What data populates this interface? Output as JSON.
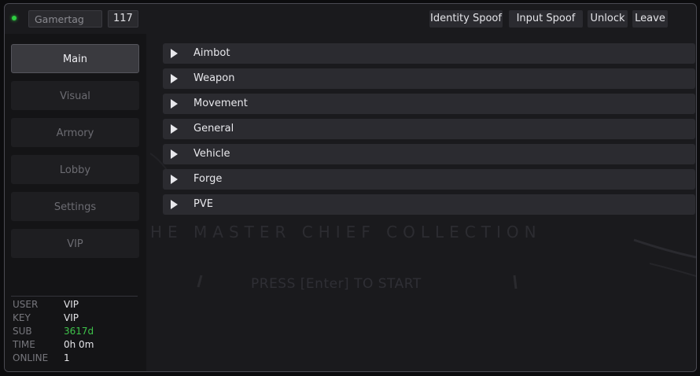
{
  "topbar": {
    "gamertag_placeholder": "Gamertag",
    "count": "117",
    "buttons": [
      "Identity Spoof",
      "Input Spoof",
      "Unlock",
      "Leave"
    ]
  },
  "sidebar": {
    "nav": [
      "Main",
      "Visual",
      "Armory",
      "Lobby",
      "Settings",
      "VIP"
    ],
    "active": "Main",
    "info": [
      {
        "key": "USER",
        "value": "VIP"
      },
      {
        "key": "KEY",
        "value": "VIP"
      },
      {
        "key": "SUB",
        "value": "3617d"
      },
      {
        "key": "TIME",
        "value": "0h 0m"
      },
      {
        "key": "ONLINE",
        "value": "1"
      }
    ]
  },
  "main": {
    "sections": [
      "Aimbot",
      "Weapon",
      "Movement",
      "General",
      "Vehicle",
      "Forge",
      "PVE"
    ]
  },
  "background": {
    "title": "HE MASTER CHIEF COLLECTION",
    "press": "PRESS [Enter] TO START"
  },
  "colors": {
    "status_online": "#2ecc40",
    "sub_value": "#3ec34a"
  }
}
